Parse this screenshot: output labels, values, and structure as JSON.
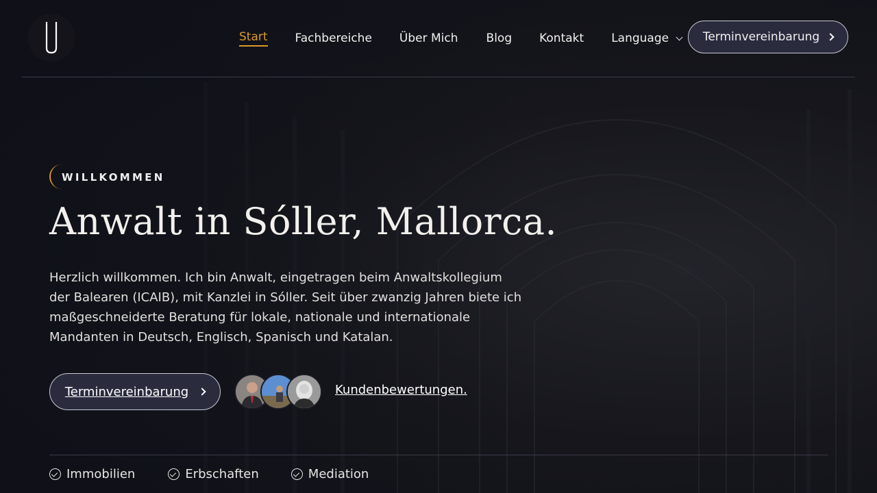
{
  "nav": {
    "items": [
      {
        "label": "Start",
        "active": true
      },
      {
        "label": "Fachbereiche"
      },
      {
        "label": "Über Mich"
      },
      {
        "label": "Blog"
      },
      {
        "label": "Kontakt"
      },
      {
        "label": "Language",
        "dropdown": true
      }
    ],
    "cta_label": "Terminvereinbarung"
  },
  "hero": {
    "eyebrow": "WILLKOMMEN",
    "title": "Anwalt in Sóller, Mallorca.",
    "text": "Herzlich willkommen. Ich bin Anwalt, eingetragen beim Anwaltskollegium der Balearen (ICAIB), mit Kanzlei in Sóller. Seit über zwanzig Jahren biete ich maßgeschneiderte Beratung für lokale, nationale und internationale Mandanten in Deutsch, Englisch, Spanisch und Katalan.",
    "cta_label": "Terminvereinbarung",
    "reviews_label": "Kundenbewertungen."
  },
  "features": [
    {
      "label": "Immobilien",
      "icon": "check-circle-icon"
    },
    {
      "label": "Erbschaften",
      "icon": "check-circle-icon"
    },
    {
      "label": "Mediation",
      "icon": "check-circle-icon"
    }
  ],
  "colors": {
    "accent": "#d99a2b",
    "button_bg": "#2a2c3e",
    "background": "#15151c"
  }
}
